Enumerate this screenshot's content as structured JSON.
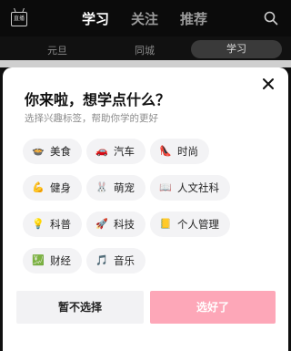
{
  "topbar": {
    "live_icon_text": "直播",
    "tabs": [
      {
        "label": "学习",
        "active": true
      },
      {
        "label": "关注",
        "active": false
      },
      {
        "label": "推荐",
        "active": false
      }
    ],
    "search_icon": "search-icon"
  },
  "subbar": {
    "tabs": [
      "元旦",
      "同城",
      "学习"
    ],
    "active": "学习"
  },
  "modal": {
    "title": "你来啦，想学点什么？",
    "subtitle": "选择兴趣标签，帮助你学的更好",
    "chips": [
      {
        "label": "美食",
        "icon": "food-icon",
        "emoji": "🍲"
      },
      {
        "label": "汽车",
        "icon": "car-icon",
        "emoji": "🚗"
      },
      {
        "label": "时尚",
        "icon": "shoe-icon",
        "emoji": "👠"
      },
      {
        "label": "健身",
        "icon": "muscle-icon",
        "emoji": "💪"
      },
      {
        "label": "萌宠",
        "icon": "rabbit-icon",
        "emoji": "🐰"
      },
      {
        "label": "人文社科",
        "icon": "book-icon",
        "emoji": "📖"
      },
      {
        "label": "科普",
        "icon": "bulb-icon",
        "emoji": "💡"
      },
      {
        "label": "科技",
        "icon": "rocket-icon",
        "emoji": "🚀"
      },
      {
        "label": "个人管理",
        "icon": "notebook-icon",
        "emoji": "📒"
      },
      {
        "label": "财经",
        "icon": "chart-icon",
        "emoji": "💹"
      },
      {
        "label": "音乐",
        "icon": "music-note-icon",
        "emoji": "🎵"
      }
    ],
    "skip_label": "暂不选择",
    "done_label": "选好了",
    "colors": {
      "done_bg": "#fda7b8",
      "chip_bg": "#f3f3f5"
    }
  }
}
